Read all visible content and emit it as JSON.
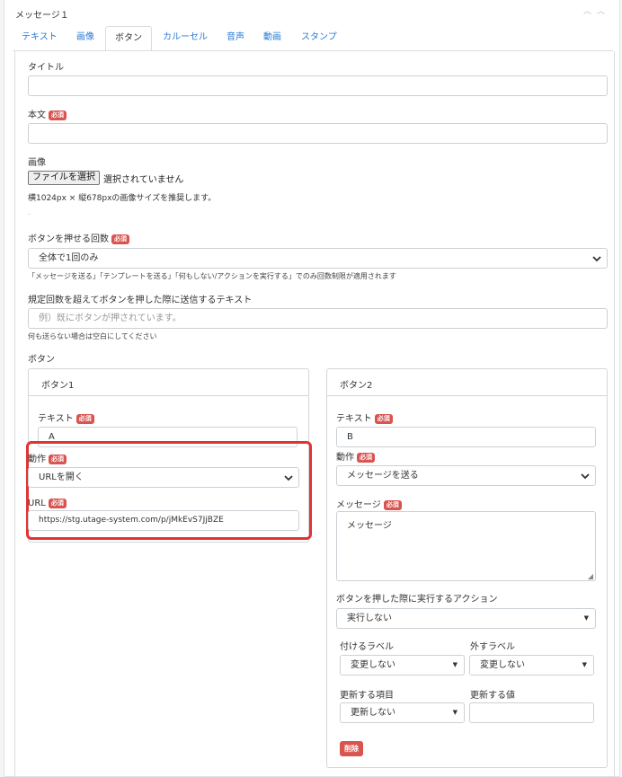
{
  "header": {
    "title": "メッセージ１"
  },
  "tabs": [
    {
      "label": "テキスト"
    },
    {
      "label": "画像"
    },
    {
      "label": "ボタン"
    },
    {
      "label": "カルーセル"
    },
    {
      "label": "音声"
    },
    {
      "label": "動画"
    },
    {
      "label": "スタンプ"
    }
  ],
  "required_badge": "必須",
  "form": {
    "title_label": "タイトル",
    "title_value": "",
    "body_label": "本文",
    "body_value": "",
    "image_label": "画像",
    "file_button": "ファイルを選択",
    "file_status": "選択されていません",
    "image_hint": "横1024px × 縦678pxの画像サイズを推奨します。",
    "press_count_label": "ボタンを押せる回数",
    "press_count_value": "全体で1回のみ",
    "press_count_help": "「メッセージを送る」「テンプレートを送る」「何もしない/アクションを実行する」でのみ回数制限が適用されます",
    "over_text_label": "規定回数を超えてボタンを押した際に送信するテキスト",
    "over_text_placeholder": "例）既にボタンが押されています。",
    "over_text_help": "何も送らない場合は空白にしてください",
    "buttons_label": "ボタン"
  },
  "button1": {
    "title": "ボタン1",
    "text_label": "テキスト",
    "text_value": "A",
    "action_label": "動作",
    "action_value": "URLを開く",
    "url_label": "URL",
    "url_value": "https://stg.utage-system.com/p/jMkEvS7JjBZE"
  },
  "button2": {
    "title": "ボタン2",
    "text_label": "テキスト",
    "text_value": "B",
    "action_label": "動作",
    "action_value": "メッセージを送る",
    "message_label": "メッセージ",
    "message_value": "メッセージ",
    "exec_action_label": "ボタンを押した際に実行するアクション",
    "exec_action_value": "実行しない",
    "add_label_label": "付けるラベル",
    "add_label_value": "変更しない",
    "remove_label_label": "外すラベル",
    "remove_label_value": "変更しない",
    "update_item_label": "更新する項目",
    "update_item_value": "更新しない",
    "update_value_label": "更新する値",
    "update_value_value": "",
    "delete_button": "削除"
  },
  "colors": {
    "accent": "#2a7bd5",
    "required": "#d9534f",
    "highlight": "#e03434"
  }
}
